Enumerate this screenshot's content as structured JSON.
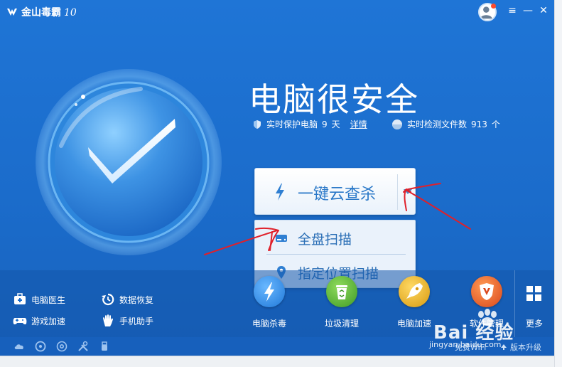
{
  "app": {
    "title": "金山毒霸",
    "version": "10"
  },
  "window_controls": {
    "menu_icon": "≡",
    "minimize_icon": "—",
    "close_icon": "✕"
  },
  "status": {
    "headline": "电脑很安全",
    "protect_prefix": "实时保护电脑",
    "protect_days": "9",
    "protect_unit": "天",
    "details_link": "详情",
    "scan_prefix": "实时检测文件数",
    "scan_count": "913",
    "scan_unit": "个"
  },
  "main_button": {
    "label": "一键云查杀"
  },
  "dropdown": {
    "items": [
      {
        "label": "全盘扫描"
      },
      {
        "label": "指定位置扫描"
      }
    ]
  },
  "quick_links": [
    {
      "label": "电脑医生",
      "icon": "medical-kit-icon"
    },
    {
      "label": "数据恢复",
      "icon": "restore-icon"
    },
    {
      "label": "游戏加速",
      "icon": "gamepad-icon"
    },
    {
      "label": "手机助手",
      "icon": "hand-icon"
    }
  ],
  "tools": [
    {
      "label": "电脑杀毒",
      "icon": "lightning-icon",
      "color": "#2f8fe0"
    },
    {
      "label": "垃圾清理",
      "icon": "recycle-bin-icon",
      "color": "#5fb33a"
    },
    {
      "label": "电脑加速",
      "icon": "rocket-icon",
      "color": "#e8b020"
    },
    {
      "label": "软件管理",
      "icon": "shield-v-icon",
      "color": "#e8561f"
    }
  ],
  "more": {
    "label": "更多"
  },
  "statusbar": {
    "wifi_label": "免费WiFi",
    "upgrade_label": "版本升级"
  },
  "watermark": {
    "brand": "Bai  经验",
    "url": "jingyan.baidu.com"
  },
  "colors": {
    "window_blue": "#1f75d6",
    "button_text": "#2a78c8",
    "annotation_red": "#e0202a"
  }
}
